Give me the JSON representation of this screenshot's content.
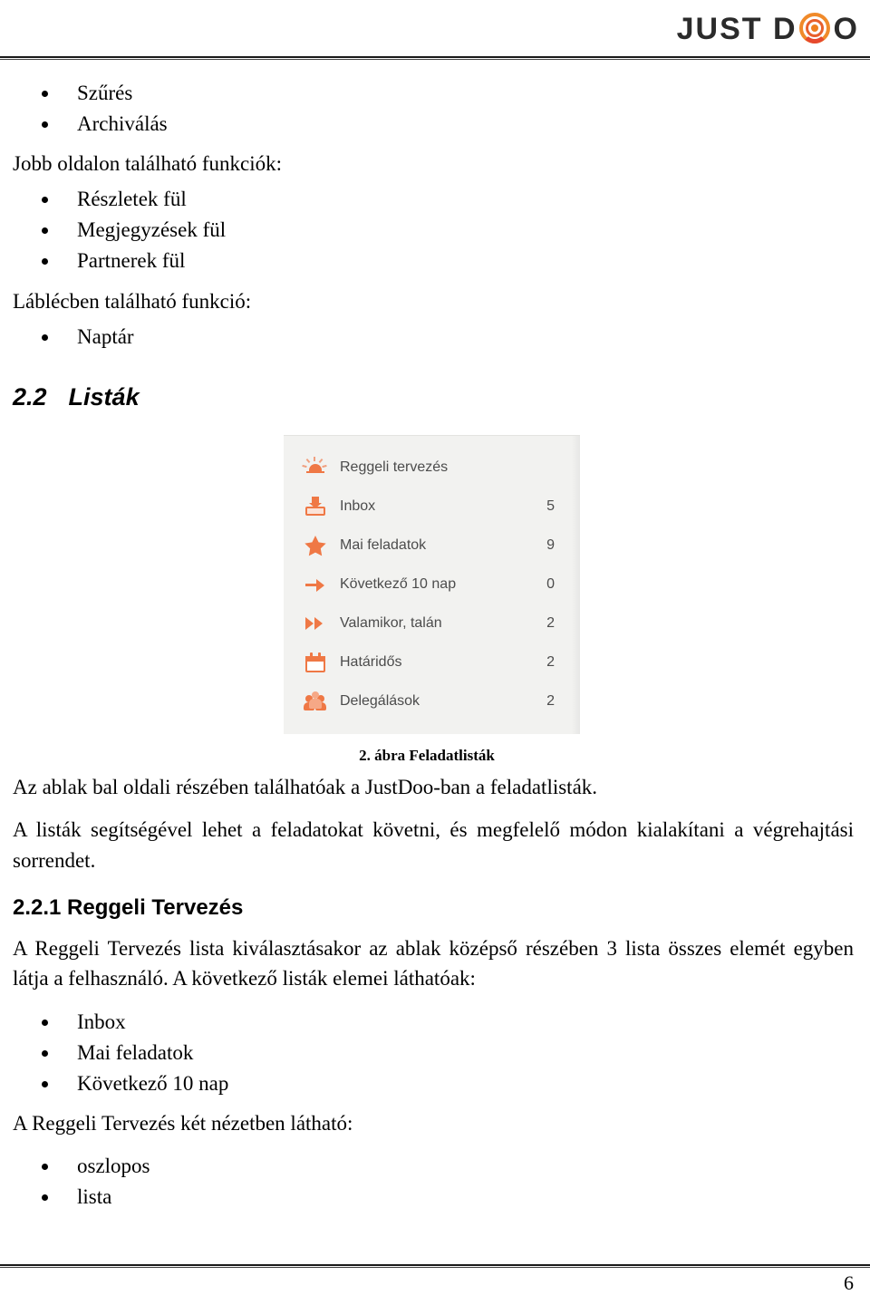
{
  "header": {
    "logo_text_left": "JUST D",
    "logo_text_right": "O",
    "logo_alt": "JUST DOO"
  },
  "intro_bullets": [
    {
      "label": "Szűrés"
    },
    {
      "label": "Archiválás"
    }
  ],
  "right_side_intro": "Jobb oldalon található funkciók:",
  "right_side_bullets": [
    {
      "label": "Részletek fül"
    },
    {
      "label": "Megjegyzések fül"
    },
    {
      "label": "Partnerek fül"
    }
  ],
  "footer_intro": "Láblécben található funkció:",
  "footer_bullets": [
    {
      "label": "Naptár"
    }
  ],
  "section": {
    "number": "2.2",
    "title": "Listák"
  },
  "figure": {
    "caption": "2. ábra Feladatlisták",
    "accent_color": "#ef7845",
    "background_color": "#f2f2f0",
    "text_color": "#4c4c4c",
    "rows": [
      {
        "icon": "sun-icon",
        "label": "Reggeli tervezés",
        "count": ""
      },
      {
        "icon": "inbox-icon",
        "label": "Inbox",
        "count": "5"
      },
      {
        "icon": "star-icon",
        "label": "Mai feladatok",
        "count": "9"
      },
      {
        "icon": "arrow-right-icon",
        "label": "Következő 10 nap",
        "count": "0"
      },
      {
        "icon": "fast-forward-icon",
        "label": "Valamikor, talán",
        "count": "2"
      },
      {
        "icon": "calendar-icon",
        "label": "Határidős",
        "count": "2"
      },
      {
        "icon": "people-icon",
        "label": "Delegálások",
        "count": "2"
      }
    ]
  },
  "paragraphs": {
    "p1": "Az ablak bal oldali részében találhatóak a JustDoo-ban a feladatlisták.",
    "p2": "A listák segítségével lehet a feladatokat követni, és megfelelő módon kialakítani a végrehajtási sorrendet.",
    "p3": "A Reggeli Tervezés lista kiválasztásakor az ablak középső részében 3 lista összes elemét egyben látja a felhasználó. A következő listák elemei láthatóak:",
    "p4": "A Reggeli Tervezés két nézetben látható:"
  },
  "subsection": {
    "title": "2.2.1 Reggeli Tervezés"
  },
  "list_bullets": [
    {
      "label": "Inbox"
    },
    {
      "label": "Mai feladatok"
    },
    {
      "label": "Következő 10 nap"
    }
  ],
  "view_bullets": [
    {
      "label": "oszlopos"
    },
    {
      "label": "lista"
    }
  ],
  "footer": {
    "page_number": "6"
  }
}
